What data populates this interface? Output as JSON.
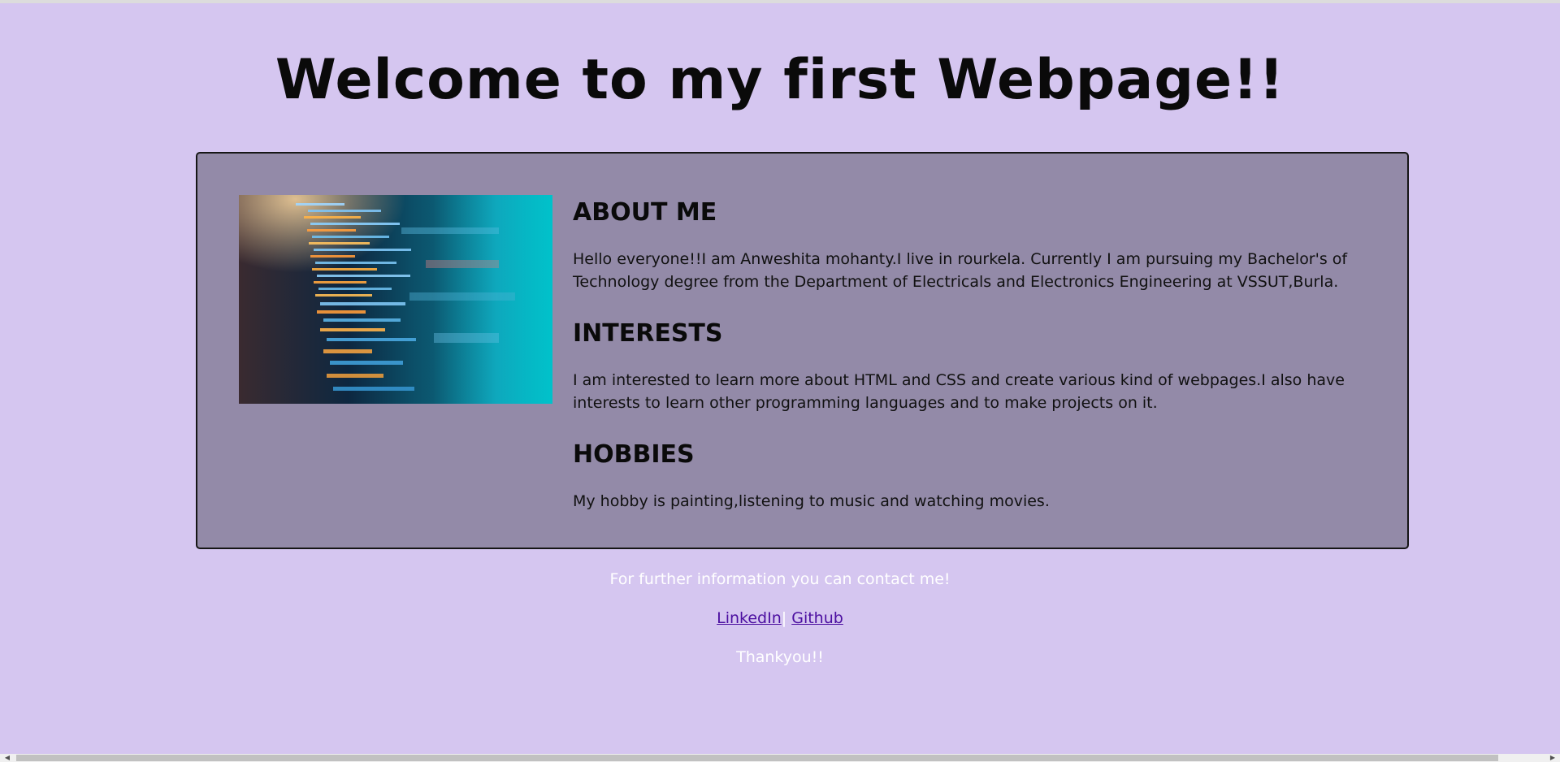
{
  "page": {
    "title": "Welcome to my first Webpage!!"
  },
  "profile": {
    "image_alt": "code on screen",
    "sections": [
      {
        "heading": "ABOUT ME",
        "body": "Hello everyone!!I am Anweshita mohanty.I live in rourkela. Currently I am pursuing my Bachelor's of Technology degree from the Department of Electricals and Electronics Engineering at VSSUT,Burla."
      },
      {
        "heading": "INTERESTS",
        "body": "I am interested to learn more about HTML and CSS and create various kind of webpages.I also have interests to learn other programming languages and to make projects on it."
      },
      {
        "heading": "HOBBIES",
        "body": "My hobby is painting,listening to music and watching movies."
      }
    ]
  },
  "footer": {
    "contact_text": "For further information you can contact me!",
    "linkedin_label": "LinkedIn",
    "separator": "|",
    "github_label": "Github",
    "thanks_text": "Thankyou!!"
  },
  "colors": {
    "background": "#d5c6f0",
    "card": "#938aa8",
    "link": "#4b0ea0"
  }
}
